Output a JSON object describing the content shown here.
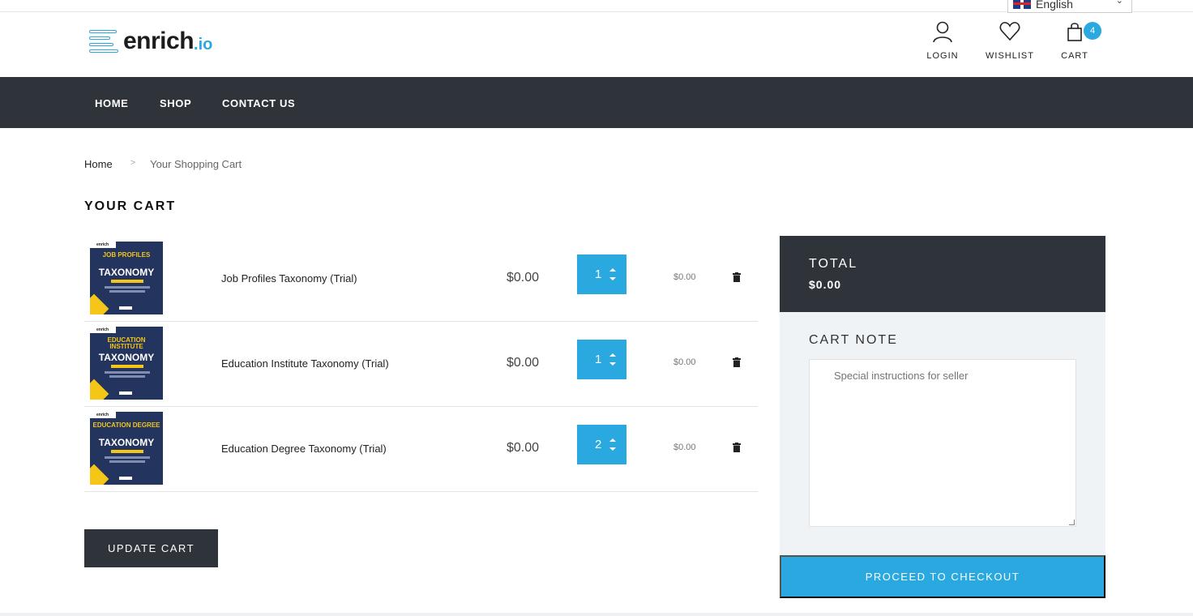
{
  "language": {
    "selected": "English"
  },
  "brand": {
    "name": "enrich",
    "suffix": ".io"
  },
  "header": {
    "login_label": "LOGIN",
    "wishlist_label": "WISHLIST",
    "cart_label": "CART",
    "cart_count": "4"
  },
  "nav": {
    "items": [
      "HOME",
      "SHOP",
      "CONTACT US"
    ]
  },
  "breadcrumb": {
    "home": "Home",
    "sep": ">",
    "current": "Your Shopping Cart"
  },
  "page_title": "YOUR CART",
  "cart": {
    "items": [
      {
        "thumb_brand": "enrich",
        "thumb_line1": "JOB PROFILES",
        "thumb_title": "TAXONOMY",
        "name": "Job Profiles Taxonomy (Trial)",
        "price": "$0.00",
        "qty": "1",
        "line_total": "$0.00"
      },
      {
        "thumb_brand": "enrich",
        "thumb_line1": "EDUCATION INSTITUTE",
        "thumb_title": "TAXONOMY",
        "name": "Education Institute Taxonomy (Trial)",
        "price": "$0.00",
        "qty": "1",
        "line_total": "$0.00"
      },
      {
        "thumb_brand": "enrich",
        "thumb_line1": "EDUCATION DEGREE",
        "thumb_title": "TAXONOMY",
        "name": "Education Degree Taxonomy (Trial)",
        "price": "$0.00",
        "qty": "2",
        "line_total": "$0.00"
      }
    ],
    "update_label": "UPDATE CART"
  },
  "summary": {
    "total_label": "TOTAL",
    "total_value": "$0.00",
    "note_label": "CART NOTE",
    "note_placeholder": "Special instructions for seller",
    "checkout_label": "PROCEED TO CHECKOUT"
  },
  "colors": {
    "accent": "#2aa8e0",
    "dark": "#2f343b",
    "panel": "#f0f3f6"
  }
}
